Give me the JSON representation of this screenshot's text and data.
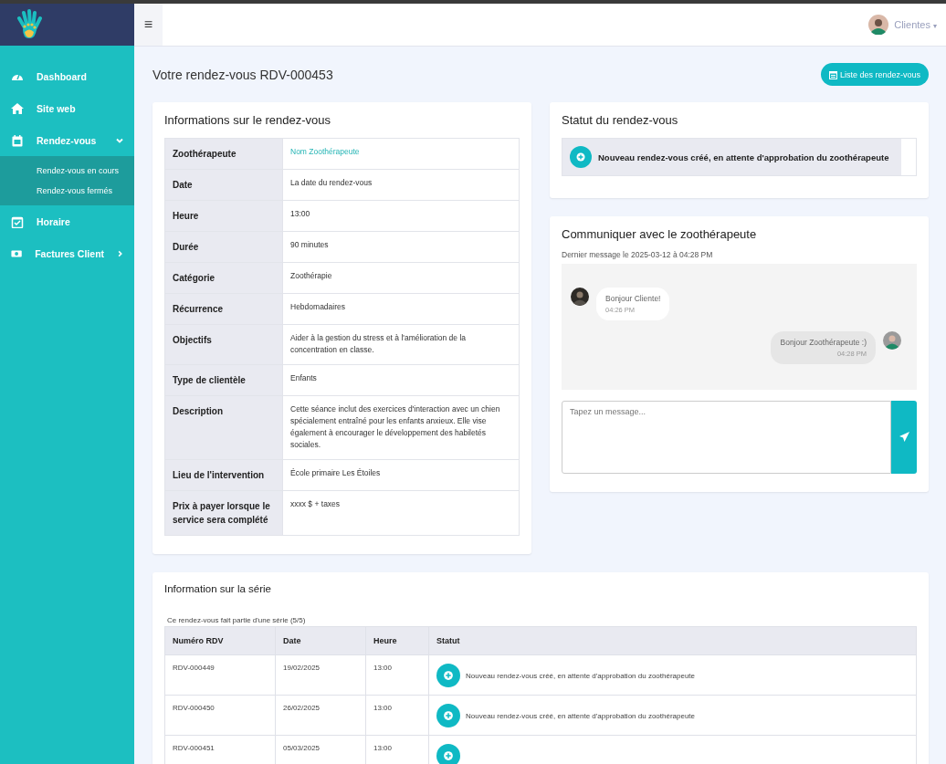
{
  "sidebar": {
    "items": [
      {
        "kind": "link",
        "label": "Dashboard"
      },
      {
        "kind": "link",
        "label": "Site web"
      },
      {
        "kind": "group",
        "label": "Rendez-vous",
        "expanded": true,
        "children": [
          {
            "label": "Rendez-vous en cours"
          },
          {
            "label": "Rendez-vous fermés"
          }
        ]
      },
      {
        "kind": "link",
        "label": "Horaire"
      },
      {
        "kind": "group",
        "label": "Factures Client",
        "expanded": false
      }
    ]
  },
  "topbar": {
    "menu_button": "≡",
    "user": "Clientes",
    "user_caret": "▾"
  },
  "page": {
    "title": "Votre rendez-vous RDV-000453",
    "list_button": "Liste des rendez-vous"
  },
  "info": {
    "title": "Informations sur le rendez-vous",
    "rows": [
      {
        "label": "Zoothérapeute",
        "value": "Nom Zoothérapeute",
        "kind": "link"
      },
      {
        "label": "Date",
        "value": "La date du rendez-vous",
        "kind": "text"
      },
      {
        "label": "Heure",
        "value": "13:00",
        "kind": "text"
      },
      {
        "label": "Durée",
        "value": "90 minutes",
        "kind": "text"
      },
      {
        "label": "Catégorie",
        "value": "Zoothérapie",
        "kind": "text"
      },
      {
        "label": "Récurrence",
        "value": "Hebdomadaires",
        "kind": "text"
      },
      {
        "label": "Objectifs",
        "value": "Aider à la gestion du stress et à l'amélioration de la concentration en classe.",
        "kind": "text"
      },
      {
        "label": "Type de clientèle",
        "value": "Enfants",
        "kind": "text"
      },
      {
        "label": "Description",
        "value": "Cette séance inclut des exercices d'interaction avec un chien spécialement entraîné pour les enfants anxieux. Elle vise également à encourager le développement des habiletés sociales.",
        "kind": "text"
      },
      {
        "label": "Lieu de l'intervention",
        "value": "École primaire Les Étoiles",
        "kind": "text"
      },
      {
        "label": "Prix à payer lorsque le service sera complété",
        "value": "xxxx $ + taxes",
        "kind": "text"
      }
    ]
  },
  "status": {
    "title": "Statut du rendez-vous",
    "text": "Nouveau rendez-vous créé, en attente d'approbation du zoothérapeute"
  },
  "chat": {
    "title": "Communiquer avec le zoothérapeute",
    "last_message": "Dernier message le 2025-03-12 à 04:28 PM",
    "messages": [
      {
        "kind": "incoming",
        "text": "Bonjour Cliente!",
        "time": "04:26 PM"
      },
      {
        "kind": "outgoing",
        "text": "Bonjour Zoothérapeute :)",
        "time": "04:28 PM"
      }
    ],
    "input": {
      "placeholder": "Tapez un message..."
    }
  },
  "series": {
    "title": "Information sur la série",
    "note": "Ce rendez-vous fait partie d'une série (5/5)",
    "columns": [
      "Numéro RDV",
      "Date",
      "Heure",
      "Statut"
    ],
    "rows": [
      {
        "number": "RDV-000449",
        "date": "19/02/2025",
        "time": "13:00",
        "status": "Nouveau rendez-vous créé, en attente d'approbation du zoothérapeute"
      },
      {
        "number": "RDV-000450",
        "date": "26/02/2025",
        "time": "13:00",
        "status": "Nouveau rendez-vous créé, en attente d'approbation du zoothérapeute"
      },
      {
        "number": "RDV-000451",
        "date": "05/03/2025",
        "time": "13:00"
      }
    ]
  }
}
